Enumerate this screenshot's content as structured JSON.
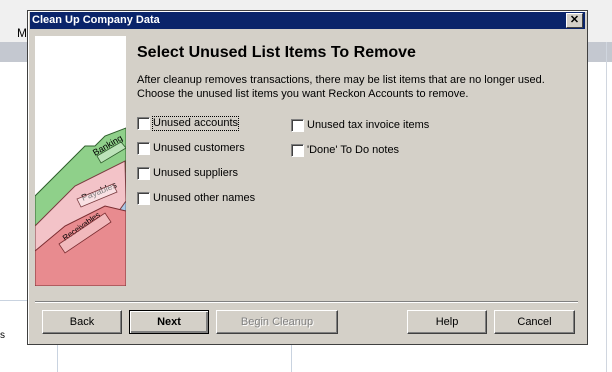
{
  "background_app": {
    "menu_fragment": "M",
    "left_fragment": "s"
  },
  "dialog": {
    "title": "Clean Up Company Data",
    "close_glyph": "✕",
    "heading": "Select Unused List Items To Remove",
    "description_line1": "After cleanup removes transactions, there may be list items that are no longer used.",
    "description_line2": "Choose the unused list items you want Reckon Accounts to remove.",
    "illustration_tabs": [
      "Banking",
      "Payables",
      "Receivables"
    ],
    "options_left": [
      {
        "label": "Unused accounts",
        "checked": false
      },
      {
        "label": "Unused customers",
        "checked": false
      },
      {
        "label": "Unused suppliers",
        "checked": false
      },
      {
        "label": "Unused other names",
        "checked": false
      }
    ],
    "options_right": [
      {
        "label": "Unused tax invoice items",
        "checked": false
      },
      {
        "label": "'Done' To Do notes",
        "checked": false
      }
    ],
    "buttons": {
      "back": "Back",
      "next": "Next",
      "begin_cleanup": "Begin Cleanup",
      "help": "Help",
      "cancel": "Cancel"
    }
  },
  "colors": {
    "dialog_face": "#d4d0c8",
    "titlebar": "#0a246a",
    "banking_folder": "#8fd08a",
    "payables_folder": "#f3c3c8",
    "receivables_folder": "#e88b8f",
    "blue_sheet": "#a9c8e8"
  }
}
